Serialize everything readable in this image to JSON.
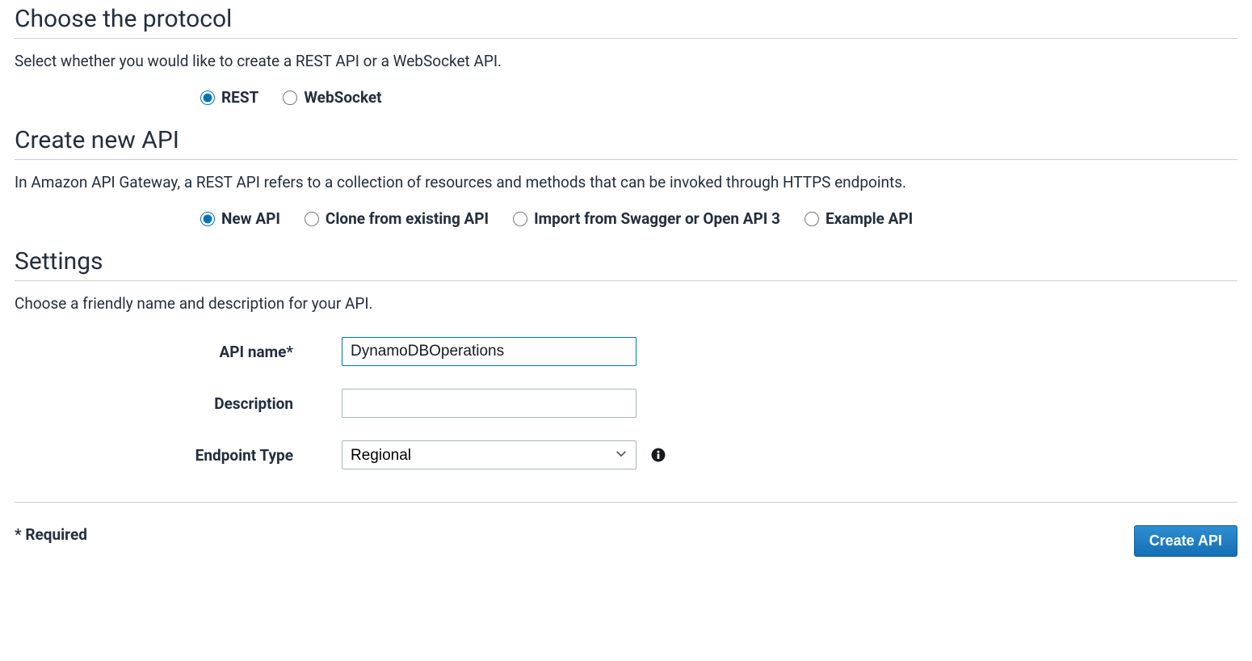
{
  "sections": {
    "protocol": {
      "title": "Choose the protocol",
      "description": "Select whether you would like to create a REST API or a WebSocket API.",
      "options": {
        "rest": "REST",
        "websocket": "WebSocket"
      }
    },
    "create": {
      "title": "Create new API",
      "description": "In Amazon API Gateway, a REST API refers to a collection of resources and methods that can be invoked through HTTPS endpoints.",
      "options": {
        "new": "New API",
        "clone": "Clone from existing API",
        "import": "Import from Swagger or Open API 3",
        "example": "Example API"
      }
    },
    "settings": {
      "title": "Settings",
      "description": "Choose a friendly name and description for your API.",
      "fields": {
        "apiName": {
          "label": "API name*",
          "value": "DynamoDBOperations"
        },
        "description": {
          "label": "Description",
          "value": ""
        },
        "endpointType": {
          "label": "Endpoint Type",
          "value": "Regional"
        }
      }
    }
  },
  "footer": {
    "required": "* Required",
    "submit": "Create API"
  }
}
